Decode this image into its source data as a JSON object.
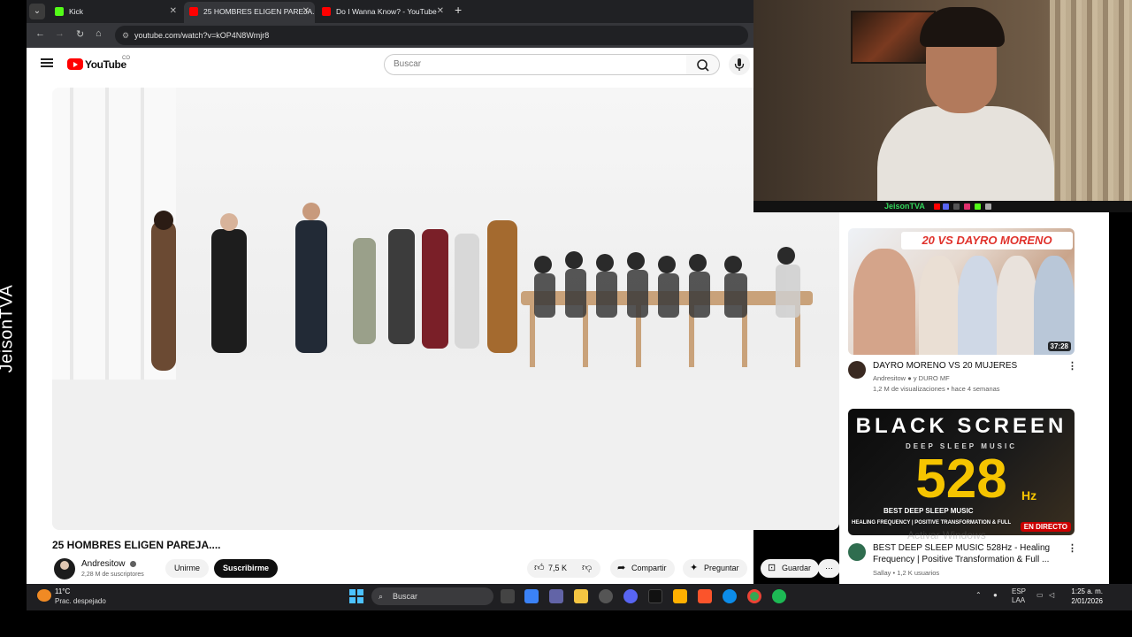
{
  "browser": {
    "tabs": [
      {
        "label": "Kick",
        "color": "#53fc18",
        "active": false
      },
      {
        "label": "25 HOMBRES ELIGEN PAREJA....",
        "color": "#ff0000",
        "active": true
      },
      {
        "label": "Do I Wanna Know? - YouTube",
        "color": "#ff0000",
        "active": false
      }
    ],
    "url": "youtube.com/watch?v=kOP4N8Wmjr8"
  },
  "youtube": {
    "logo_text": "YouTube",
    "country_code": "CO",
    "search_placeholder": "Buscar"
  },
  "video": {
    "title": "25 HOMBRES ELIGEN PAREJA....",
    "channel": "Andresitow",
    "subscribers": "2,28 M de suscriptores",
    "join_label": "Unirme",
    "subscribe_label": "Suscribirme",
    "likes": "7,5 K",
    "share_label": "Compartir",
    "ask_label": "Preguntar",
    "save_label": "Guardar"
  },
  "webcam": {
    "name": "JeisonTVA"
  },
  "watermark": "JeisonTVA",
  "recommendations": [
    {
      "thumb_text": "20 VS DAYRO MORENO",
      "duration": "37:28",
      "title": "DAYRO MORENO VS 20 MUJERES",
      "channel": "Andresitow",
      "collab": "y DURO MF",
      "meta": "1,2 M de visualizaciones • hace 4 semanas"
    },
    {
      "thumb_line1": "BLACK SCREEN",
      "thumb_line2": "DEEP SLEEP MUSIC",
      "thumb_line3": "528",
      "thumb_hz": "Hz",
      "thumb_line4": "BEST DEEP SLEEP MUSIC",
      "thumb_line5": "HEALING FREQUENCY | POSITIVE TRANSFORMATION & FULL",
      "live_badge": "EN DIRECTO",
      "title": "BEST DEEP SLEEP MUSIC 528Hz - Healing Frequency | Positive Transformation & Full ...",
      "channel": "Sallay",
      "meta": "Sallay • 1,2 K usuarios"
    }
  ],
  "activate_windows": "Activar Windows",
  "taskbar": {
    "temperature": "11°C",
    "weather": "Prac. despejado",
    "search_label": "Buscar",
    "lang": "ESP",
    "lang2": "LAA",
    "time": "1:25 a. m.",
    "date": "2/01/2026"
  }
}
